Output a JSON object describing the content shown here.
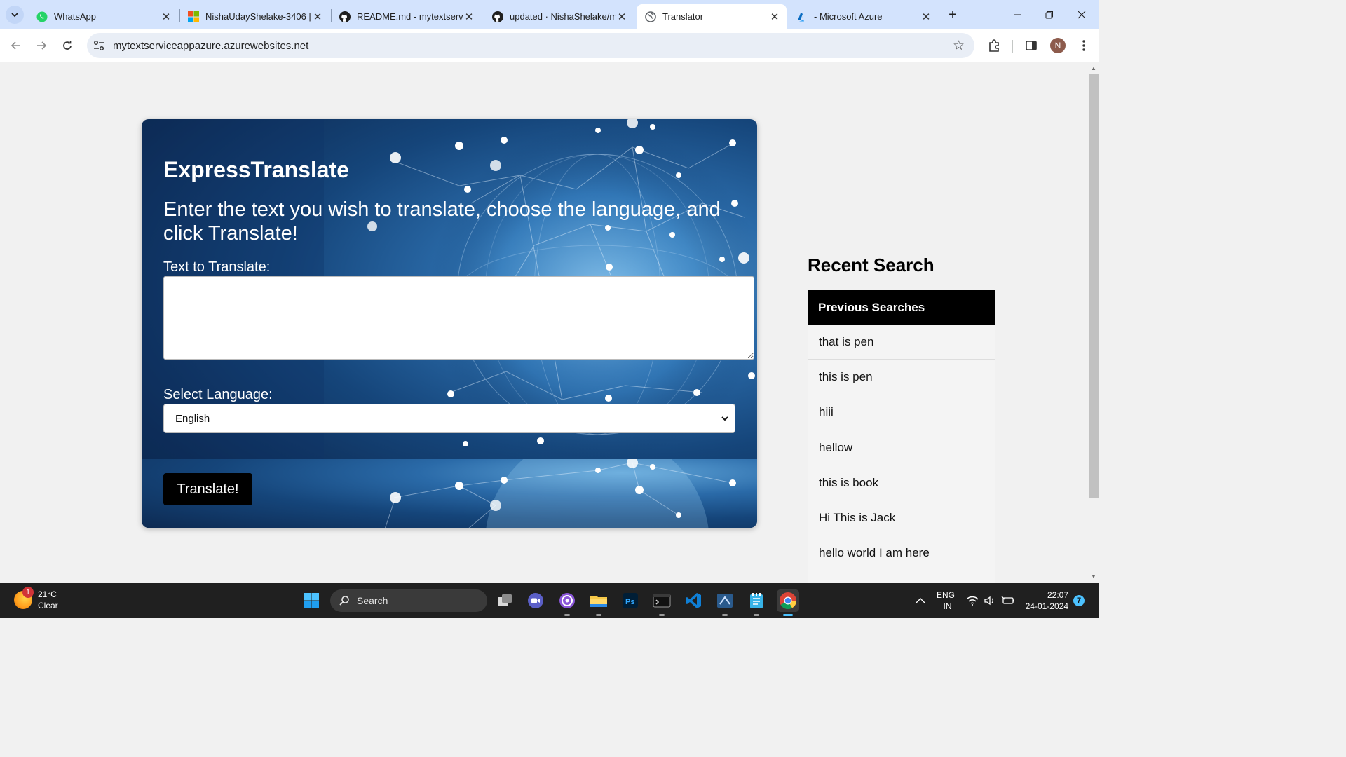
{
  "browser": {
    "tabs": [
      {
        "title": "WhatsApp",
        "icon": "whatsapp-icon"
      },
      {
        "title": "NishaUdayShelake-3406 | I",
        "icon": "microsoft-icon"
      },
      {
        "title": "README.md - mytextservic",
        "icon": "github-icon"
      },
      {
        "title": "updated · NishaShelake/m",
        "icon": "github-icon"
      },
      {
        "title": "Translator",
        "icon": "globe-icon",
        "active": true
      },
      {
        "title": "- Microsoft Azure",
        "icon": "azure-icon"
      }
    ],
    "url": "mytextserviceappazure.azurewebsites.net",
    "profile_initial": "N"
  },
  "page": {
    "brand": "ExpressTranslate",
    "lead": "Enter the text you wish to translate, choose the language, and click Translate!",
    "text_label": "Text to Translate:",
    "text_value": "",
    "language_label": "Select Language:",
    "language_selected": "English",
    "translate_button": "Translate!",
    "recent_title": "Recent Search",
    "recent_header": "Previous Searches",
    "recent_items": [
      "that is pen",
      "this is pen",
      "hiii",
      "hellow",
      "this is book",
      "Hi This is Jack",
      "hello world I am here"
    ]
  },
  "taskbar": {
    "weather_temp": "21°C",
    "weather_desc": "Clear",
    "weather_badge": "1",
    "search_placeholder": "Search",
    "lang_line1": "ENG",
    "lang_line2": "IN",
    "time": "22:07",
    "date": "24-01-2024",
    "notification_count": "7"
  },
  "colors": {
    "tab_bar": "#d3e3fd",
    "card_bg": "#15457a",
    "button_bg": "#000000",
    "table_header": "#000000"
  }
}
